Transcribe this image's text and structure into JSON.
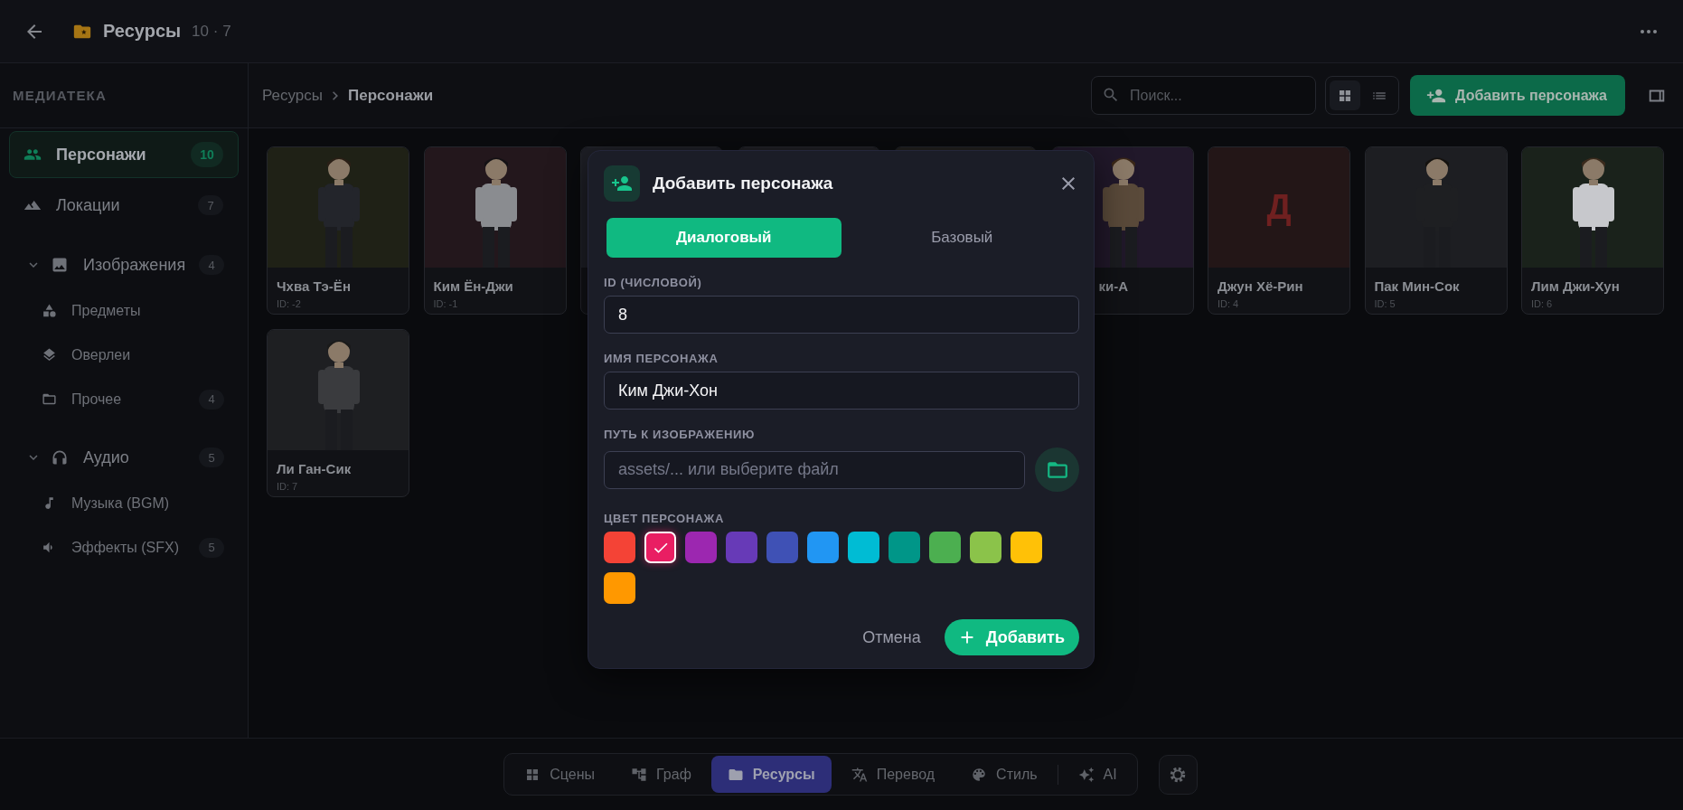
{
  "top_bar": {
    "title": "Ресурсы",
    "counts": "10 · 7"
  },
  "sidebar": {
    "heading": "МЕДИАТЕКА",
    "items": [
      {
        "kind": "item",
        "label": "Персонажи",
        "count": "10",
        "selected": true
      },
      {
        "kind": "item",
        "label": "Локации",
        "count": "7",
        "selected": false
      },
      {
        "kind": "group",
        "label": "Изображения",
        "count": "4",
        "expanded": true,
        "children": [
          {
            "label": "Предметы"
          },
          {
            "label": "Оверлеи"
          },
          {
            "label": "Прочее",
            "count": "4"
          }
        ]
      },
      {
        "kind": "group",
        "label": "Аудио",
        "count": "5",
        "expanded": true,
        "children": [
          {
            "label": "Музыка (BGM)"
          },
          {
            "label": "Эффекты (SFX)",
            "count": "5"
          }
        ]
      }
    ]
  },
  "breadcrumb": [
    "Ресурсы",
    "Персонажи"
  ],
  "search": {
    "placeholder": "Поиск..."
  },
  "view_modes": [
    {
      "kind": "grid",
      "selected": true
    },
    {
      "kind": "list",
      "selected": false
    }
  ],
  "add_button": "Добавить персонажа",
  "cards": [
    {
      "kind": "portrait",
      "name": "Чхва Тэ-Ён",
      "id_label": "ID: -2"
    },
    {
      "kind": "portrait",
      "name": "Ким Ён-Джи",
      "id_label": "ID: -1"
    },
    {
      "kind": "covered"
    },
    {
      "kind": "covered"
    },
    {
      "kind": "covered"
    },
    {
      "kind": "portrait",
      "name": "ки-А",
      "clipped": true
    },
    {
      "kind": "letter",
      "letter": "Д",
      "name": "Джун Хё-Рин",
      "id_label": "ID: 4"
    },
    {
      "kind": "portrait",
      "name": "Пак Мин-Сок",
      "id_label": "ID: 5"
    },
    {
      "kind": "portrait",
      "name": "Лим Джи-Хун",
      "id_label": "ID: 6"
    },
    {
      "kind": "portrait",
      "name": "Ли Ган-Сик",
      "id_label": "ID: 7"
    }
  ],
  "modal": {
    "title": "Добавить персонажа",
    "tabs": [
      {
        "label": "Диалоговый",
        "selected": true
      },
      {
        "label": "Базовый",
        "selected": false
      }
    ],
    "fields": [
      {
        "kind": "text",
        "label": "ID (ЧИСЛОВОЙ)",
        "value": "8"
      },
      {
        "kind": "text",
        "label": "ИМЯ ПЕРСОНАЖА",
        "value": "Ким Джи-Хон"
      },
      {
        "kind": "file",
        "label": "ПУТЬ К ИЗОБРАЖЕНИЮ",
        "placeholder": "assets/... или выберите файл"
      }
    ],
    "color_label": "ЦВЕТ ПЕРСОНАЖА",
    "swatches": [
      {
        "color": "#f44336",
        "selected": false
      },
      {
        "color": "#e91e63",
        "selected": true
      },
      {
        "color": "#9c27b0",
        "selected": false
      },
      {
        "color": "#673ab7",
        "selected": false
      },
      {
        "color": "#3f51b5",
        "selected": false
      },
      {
        "color": "#2196f3",
        "selected": false
      },
      {
        "color": "#00bcd4",
        "selected": false
      },
      {
        "color": "#009688",
        "selected": false
      },
      {
        "color": "#4caf50",
        "selected": false
      },
      {
        "color": "#8bc34a",
        "selected": false
      },
      {
        "color": "#ffc107",
        "selected": false
      },
      {
        "color": "#ff9800",
        "selected": false
      }
    ],
    "cancel": "Отмена",
    "submit": "Добавить"
  },
  "bottom_nav": {
    "items": [
      {
        "label": "Сцены",
        "selected": false
      },
      {
        "label": "Граф",
        "selected": false
      },
      {
        "label": "Ресурсы",
        "selected": true
      },
      {
        "label": "Перевод",
        "selected": false
      },
      {
        "label": "Стиль",
        "selected": false
      },
      {
        "label": "AI",
        "selected": false
      }
    ]
  }
}
